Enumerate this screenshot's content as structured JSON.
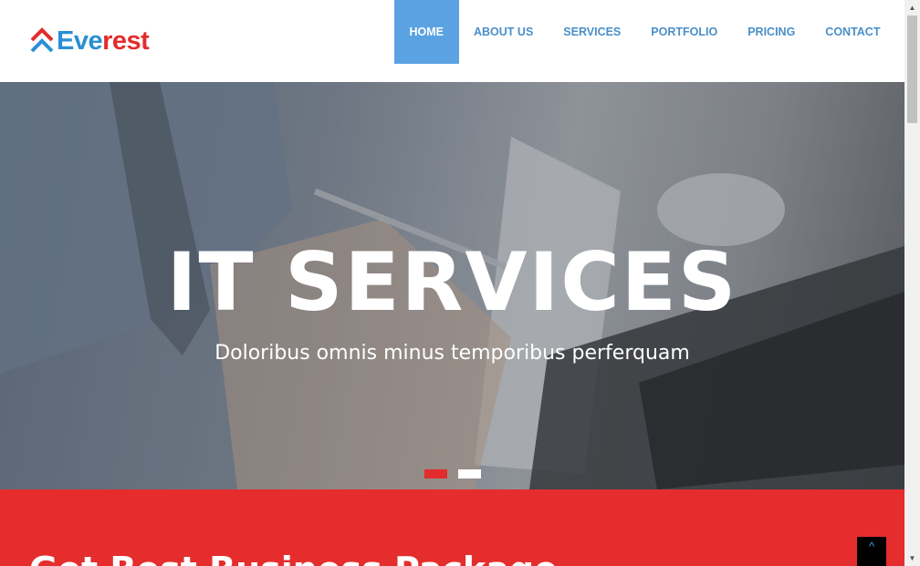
{
  "brand": {
    "part1": "Eve",
    "part2": "rest"
  },
  "nav": [
    {
      "label": "HOME",
      "active": true
    },
    {
      "label": "ABOUT US",
      "active": false
    },
    {
      "label": "SERVICES",
      "active": false
    },
    {
      "label": "PORTFOLIO",
      "active": false
    },
    {
      "label": "PRICING",
      "active": false
    },
    {
      "label": "CONTACT",
      "active": false
    }
  ],
  "hero": {
    "title": "IT SERVICES",
    "subtitle": "Doloribus omnis minus temporibus perferquam",
    "slide_count": 2,
    "active_slide": 1
  },
  "section": {
    "heading": "Get Best Business Package"
  },
  "back_to_top": {
    "icon": "chevron-up-icon",
    "glyph": "^"
  },
  "colors": {
    "accent_blue": "#5aa2e2",
    "brand_red": "#e32c2c",
    "section_red": "#e52d2d"
  }
}
